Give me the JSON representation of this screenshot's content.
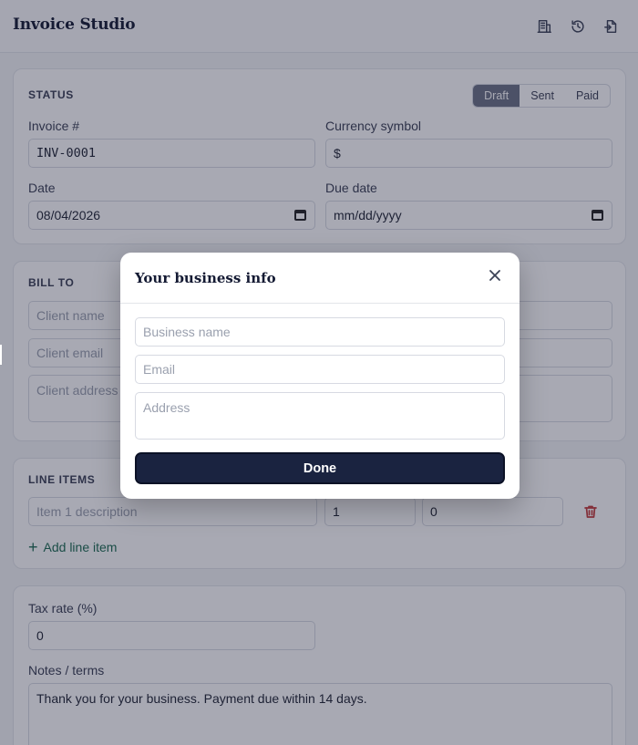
{
  "app": {
    "title": "Invoice Studio"
  },
  "toolbar": {
    "icons": [
      "building-icon",
      "history-icon",
      "export-icon"
    ]
  },
  "status": {
    "title": "STATUS",
    "options": [
      "Draft",
      "Sent",
      "Paid"
    ],
    "selected": "Draft",
    "invoice_label": "Invoice #",
    "invoice_value": "INV-0001",
    "currency_label": "Currency symbol",
    "currency_value": "$",
    "date_label": "Date",
    "date_value": "08/04/2026",
    "due_label": "Due date",
    "due_placeholder": "mm/dd/yyyy"
  },
  "bill_to": {
    "title": "BILL TO",
    "client_name_ph": "Client name",
    "client_email_ph": "Client email",
    "client_address_ph": "Client address"
  },
  "line_items": {
    "title": "LINE ITEMS",
    "item_ph": "Item 1 description",
    "qty": "1",
    "price": "0",
    "add_label": "Add line item"
  },
  "totals": {
    "tax_label": "Tax rate (%)",
    "tax_value": "0",
    "notes_label": "Notes / terms",
    "notes_value": "Thank you for your business. Payment due within 14 days."
  },
  "modal": {
    "title": "Your business info",
    "business_ph": "Business name",
    "email_ph": "Email",
    "address_ph": "Address",
    "done_label": "Done"
  },
  "colors": {
    "accent": "#1a2340",
    "add_link": "#1c6b52",
    "danger": "#c43b3b",
    "seg_active": "#6b7285"
  }
}
